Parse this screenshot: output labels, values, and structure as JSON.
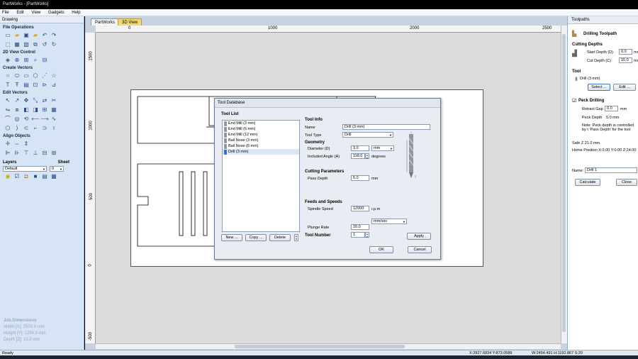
{
  "window": {
    "title": "PartWorks - [PartWorks]"
  },
  "menu": [
    "File",
    "Edit",
    "View",
    "Gadgets",
    "Help"
  ],
  "left_panel": {
    "title": "Drawing",
    "sections": {
      "file_operations": "File Operations",
      "view_control": "2D View Control",
      "create_vectors": "Create Vectors",
      "edit_vectors": "Edit Vectors",
      "align_objects": "Align Objects"
    },
    "layers_label": "Layers",
    "sheet_label": "Sheet",
    "layer_value": "Default",
    "sheet_value": "0",
    "job_dimensions": {
      "title": "Job Dimensions",
      "width": "Width  [X]: 2500.0 mm",
      "height": "Height [Y]: 1250.0 mm",
      "depth": "Depth  [Z]: 15.0 mm"
    }
  },
  "doc_tabs": [
    "PartWorks",
    "3D View"
  ],
  "ruler": {
    "top": [
      "0",
      "1000",
      "2000",
      "2500"
    ],
    "left": [
      "1500",
      "1000",
      "500",
      "0",
      "-500"
    ]
  },
  "dialog": {
    "title": "Tool Database",
    "tool_list_label": "Tool List",
    "tools": [
      "End Mill (3 mm)",
      "End Mill (6 mm)",
      "End Mill (12 mm)",
      "Ball Nose (3 mm)",
      "Ball Nose (6 mm)",
      "Drill (3 mm)"
    ],
    "selected_tool_index": 5,
    "buttons": {
      "new": "New ...",
      "copy": "Copy ...",
      "delete": "Delete",
      "apply": "Apply",
      "ok": "OK",
      "cancel": "Cancel"
    },
    "tool_info_label": "Tool Info",
    "name_label": "Name",
    "name_value": "Drill (3 mm)",
    "tool_type_label": "Tool Type",
    "tool_type_value": "Drill",
    "geometry_label": "Geometry",
    "diameter_label": "Diameter (D)",
    "diameter_value": "3.0",
    "diameter_unit": "mm",
    "angle_label": "Included Angle (A)",
    "angle_value": "118.0",
    "angle_unit": "degrees",
    "cutting_params_label": "Cutting Parameters",
    "pass_depth_label": "Pass Depth",
    "pass_depth_value": "5.0",
    "pass_depth_unit": "mm",
    "feeds_label": "Feeds and Speeds",
    "spindle_label": "Spindle Speed",
    "spindle_value": "12000",
    "spindle_unit": "r.p.m",
    "feed_unit": "mm/sec",
    "plunge_label": "Plunge Rate",
    "plunge_value": "20.0",
    "tool_number_label": "Tool Number",
    "tool_number_value": "1"
  },
  "right_panel": {
    "title": "Toolpaths",
    "heading": "Drilling Toolpath",
    "cutting_depths_label": "Cutting Depths",
    "start_depth_label": "Start Depth (D)",
    "start_depth_value": "0.0",
    "cut_depth_label": "Cut Depth (C)",
    "cut_depth_value": "15.0",
    "unit_mm": "mm",
    "tool_label": "Tool",
    "tool_value": "Drill (3 mm)",
    "select_button": "Select ...",
    "edit_button": "Edit ...",
    "peck_label": "Peck Drilling",
    "retract_label": "Retract Gap",
    "retract_value": "0.0",
    "peck_depth_label": "Peck Depth",
    "peck_depth_value": "5.0 mm",
    "note": "Note: Peck depth is controlled by t 'Pass Depth' for the tool",
    "safe_z": "Safe Z        21.0 mm",
    "home_position": "Home Position   X:0.00 Y:0.00 Z:24.00",
    "name_label": "Name:",
    "name_value": "Drill 1",
    "calculate_button": "Calculate",
    "close_button": "Close"
  },
  "status": {
    "left": "Ready",
    "coords": "X:2827.6834 Y:873.0589",
    "size": "W:2454.491  H:1192.867  S:20"
  }
}
